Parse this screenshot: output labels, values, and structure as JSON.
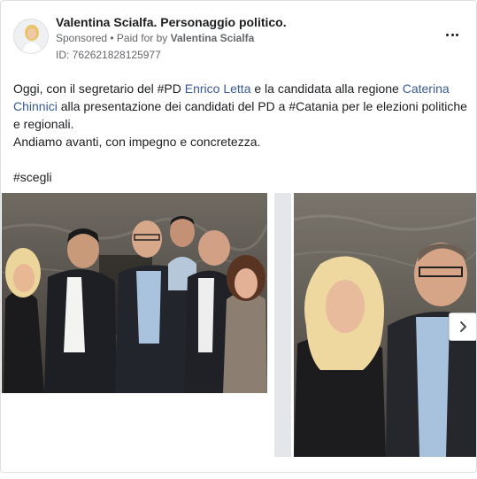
{
  "post": {
    "page_name": "Valentina Scialfa. Personaggio politico.",
    "sponsored_label": "Sponsored",
    "separator": " • ",
    "paid_for_prefix": "Paid for by ",
    "paid_for_name": "Valentina Scialfa",
    "ad_id": "ID: 762621828125977",
    "text": {
      "p1_a": "Oggi, con il segretario del #PD ",
      "link_letta": "Enrico Letta",
      "p1_b": " e la candidata alla regione ",
      "link_chinnici": "Caterina Chinnici",
      "p1_c": " alla presentazione dei candidati del PD a #Catania per le elezioni politiche e regionali.",
      "p2": "Andiamo avanti, con impegno e concretezza.",
      "hashtag": "#scegli"
    }
  },
  "icons": {
    "more": "more-options-icon",
    "next": "chevron-right-icon",
    "avatar": "page-avatar"
  },
  "colors": {
    "link": "#385898",
    "text": "#1c1e21",
    "secondary": "#65676b",
    "border": "#dcdfe4"
  }
}
